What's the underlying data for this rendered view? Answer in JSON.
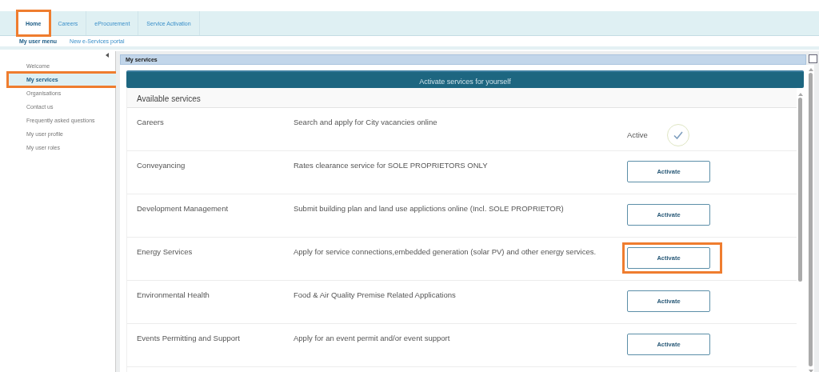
{
  "tabs": [
    {
      "label": "Home",
      "selected": true,
      "highlighted": true
    },
    {
      "label": "Careers",
      "selected": false,
      "highlighted": false
    },
    {
      "label": "eProcurement",
      "selected": false,
      "highlighted": false
    },
    {
      "label": "Service Activation",
      "selected": false,
      "highlighted": false
    }
  ],
  "submenu": [
    {
      "label": "My user menu",
      "selected": true
    },
    {
      "label": "New e-Services portal",
      "selected": false
    }
  ],
  "sidebar": {
    "items": [
      {
        "label": "Welcome",
        "selected": false,
        "highlighted": false
      },
      {
        "label": "My services",
        "selected": true,
        "highlighted": true
      },
      {
        "label": "Organisations",
        "selected": false,
        "highlighted": false
      },
      {
        "label": "Contact us",
        "selected": false,
        "highlighted": false
      },
      {
        "label": "Frequently asked questions",
        "selected": false,
        "highlighted": false
      },
      {
        "label": "My user profile",
        "selected": false,
        "highlighted": false
      },
      {
        "label": "My user roles",
        "selected": false,
        "highlighted": false
      }
    ]
  },
  "panel": {
    "title": "My services",
    "banner": "Activate services for yourself",
    "section_title": "Available services",
    "services": [
      {
        "name": "Careers",
        "description": "Search and apply for City vacancies online",
        "kind": "active",
        "status": "Active"
      },
      {
        "name": "Conveyancing",
        "description": "Rates clearance service for SOLE PROPRIETORS ONLY",
        "kind": "button",
        "button": "Activate",
        "highlighted": false
      },
      {
        "name": "Development Management",
        "description": "Submit building plan and land use applictions online (Incl. SOLE PROPRIETOR)",
        "kind": "button",
        "button": "Activate",
        "highlighted": false
      },
      {
        "name": "Energy Services",
        "description": "Apply for service connections,embedded generation (solar PV) and other energy services.",
        "kind": "button",
        "button": "Activate",
        "highlighted": true
      },
      {
        "name": "Environmental Health",
        "description": "Food & Air Quality Premise Related Applications",
        "kind": "button",
        "button": "Activate",
        "highlighted": false
      },
      {
        "name": "Events Permitting and Support",
        "description": "Apply for an event permit and/or event support",
        "kind": "button",
        "button": "Activate",
        "highlighted": false
      }
    ]
  }
}
